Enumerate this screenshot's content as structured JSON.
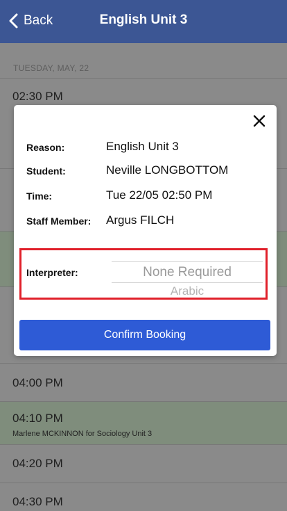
{
  "nav": {
    "back_label": "Back",
    "title": "English Unit 3"
  },
  "list": {
    "date_header": "TUESDAY, MAY, 22",
    "slots": [
      {
        "time": "02:30 PM"
      },
      {
        "time": "04:00 PM"
      },
      {
        "time": "04:10 PM",
        "detail": "Marlene MCKINNON for Sociology Unit 3"
      },
      {
        "time": "04:20 PM"
      },
      {
        "time": "04:30 PM"
      }
    ]
  },
  "modal": {
    "close_icon": "close-icon",
    "reason_label": "Reason:",
    "reason_value": "English Unit 3",
    "student_label": "Student:",
    "student_value": "Neville LONGBOTTOM",
    "time_label": "Time:",
    "time_value": "Tue 22/05 02:50 PM",
    "staff_label": "Staff Member:",
    "staff_value": "Argus FILCH",
    "interpreter_label": "Interpreter:",
    "interpreter_selected": "None Required",
    "interpreter_next": "Arabic",
    "confirm_label": "Confirm Booking"
  },
  "colors": {
    "nav_bg": "#3c5694",
    "confirm_bg": "#2e5bd6",
    "highlight_border": "#e0202a"
  }
}
